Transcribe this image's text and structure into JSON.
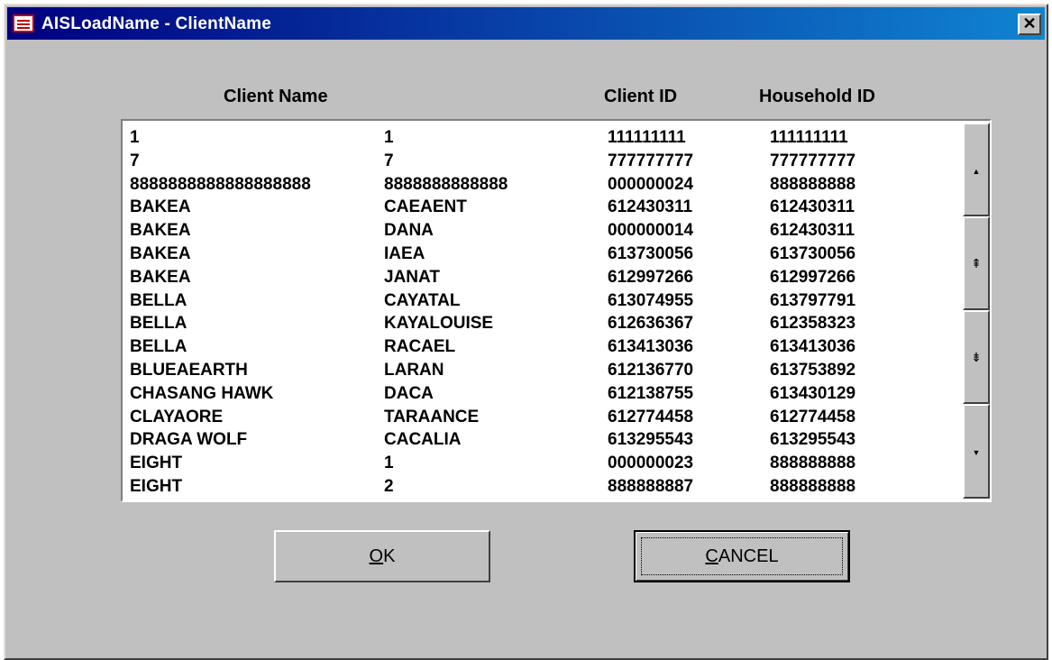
{
  "window": {
    "title": "AISLoadName - ClientName",
    "close_label": "✕"
  },
  "headers": {
    "client_name": "Client Name",
    "client_id": "Client ID",
    "household_id": "Household ID"
  },
  "rows": [
    {
      "last": "1",
      "first": "1",
      "client_id": "111111111",
      "household_id": "111111111"
    },
    {
      "last": "7",
      "first": "7",
      "client_id": "777777777",
      "household_id": "777777777"
    },
    {
      "last": "8888888888888888888",
      "first": "8888888888888",
      "client_id": "000000024",
      "household_id": "888888888"
    },
    {
      "last": "BAKEA",
      "first": "CAEAENT",
      "client_id": "612430311",
      "household_id": "612430311"
    },
    {
      "last": "BAKEA",
      "first": "DANA",
      "client_id": "000000014",
      "household_id": "612430311"
    },
    {
      "last": "BAKEA",
      "first": "IAEA",
      "client_id": "613730056",
      "household_id": "613730056"
    },
    {
      "last": "BAKEA",
      "first": "JANAT",
      "client_id": "612997266",
      "household_id": "612997266"
    },
    {
      "last": "BELLA",
      "first": "CAYATAL",
      "client_id": "613074955",
      "household_id": "613797791"
    },
    {
      "last": "BELLA",
      "first": "KAYALOUISE",
      "client_id": "612636367",
      "household_id": "612358323"
    },
    {
      "last": "BELLA",
      "first": "RACAEL",
      "client_id": "613413036",
      "household_id": "613413036"
    },
    {
      "last": "BLUEAEARTH",
      "first": "LARAN",
      "client_id": "612136770",
      "household_id": "613753892"
    },
    {
      "last": "CHASANG HAWK",
      "first": "DACA",
      "client_id": "612138755",
      "household_id": "613430129"
    },
    {
      "last": "CLAYAORE",
      "first": "TARAANCE",
      "client_id": "612774458",
      "household_id": "612774458"
    },
    {
      "last": "DRAGA WOLF",
      "first": "CACALIA",
      "client_id": "613295543",
      "household_id": "613295543"
    },
    {
      "last": "EIGHT",
      "first": "1",
      "client_id": "000000023",
      "household_id": "888888888"
    },
    {
      "last": "EIGHT",
      "first": "2",
      "client_id": "888888887",
      "household_id": "888888888"
    }
  ],
  "scrollbar": {
    "up_icon": "▲",
    "page_up_icon": "⇞",
    "page_down_icon": "⇟",
    "down_icon": "▼"
  },
  "buttons": {
    "ok_mnemonic": "O",
    "ok_rest": "K",
    "cancel_mnemonic": "C",
    "cancel_rest": "ANCEL"
  }
}
